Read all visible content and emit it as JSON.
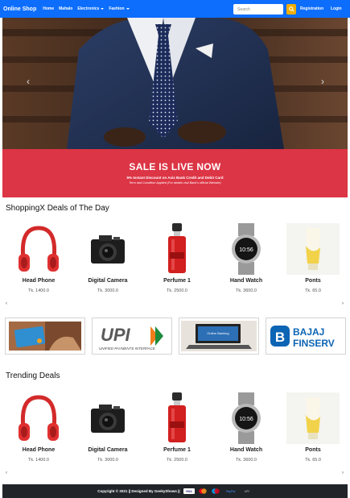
{
  "navbar": {
    "brand": "Online Shop",
    "links": [
      "Home",
      "Mahalo",
      "Electronics",
      "Fashion"
    ],
    "search_placeholder": "Search",
    "register_label": "Registration",
    "login_label": "Login",
    "colors": {
      "bar": "#0d6efd",
      "search_button": "#f0ad00"
    }
  },
  "carousel": {
    "prev_icon": "chevron-left-icon",
    "next_icon": "chevron-right-icon"
  },
  "sale": {
    "title": "SALE IS LIVE NOW",
    "subtitle": "5% Instant Discount on Axis Bank Credit and Debit Card",
    "terms": "Term and Condition Applied (For details visit Bank's official Website)",
    "color": "#dc3545"
  },
  "deals_section": {
    "title": "ShoppingX Deals of The Day",
    "products": [
      {
        "name": "Head Phone",
        "price": "Tk. 1400.0",
        "icon": "headphone-icon"
      },
      {
        "name": "Digital Camera",
        "price": "Tk. 3000.0",
        "icon": "camera-icon"
      },
      {
        "name": "Perfume 1",
        "price": "Tk. 2500.0",
        "icon": "perfume-icon"
      },
      {
        "name": "Hand Watch",
        "price": "Tk. 3600.0",
        "icon": "watch-icon"
      },
      {
        "name": "Ponts",
        "price": "Tk. 65.0",
        "icon": "cream-tube-icon"
      }
    ]
  },
  "payment_banners": {
    "upi_text": "UPI",
    "upi_sub": "UNIFIED PAYMENTS INTERFACE",
    "bajaj_line1": "BAJAJ",
    "bajaj_line2": "FINSERV",
    "bajaj_letter": "B",
    "laptop_screen_text": "Online Banking"
  },
  "trending_section": {
    "title": "Trending Deals",
    "products": [
      {
        "name": "Head Phone",
        "price": "Tk. 1400.0",
        "icon": "headphone-icon"
      },
      {
        "name": "Digital Camera",
        "price": "Tk. 3000.0",
        "icon": "camera-icon"
      },
      {
        "name": "Perfume 1",
        "price": "Tk. 2500.0",
        "icon": "perfume-icon"
      },
      {
        "name": "Hand Watch",
        "price": "Tk. 3600.0",
        "icon": "watch-icon"
      },
      {
        "name": "Ponts",
        "price": "Tk. 65.0",
        "icon": "cream-tube-icon"
      }
    ]
  },
  "footer": {
    "text": "Copyright © 2021 || Designed By GeekyShows ||",
    "badges": [
      "VISA",
      "",
      "",
      "PayPal",
      "UPI"
    ],
    "background": "#212529"
  }
}
